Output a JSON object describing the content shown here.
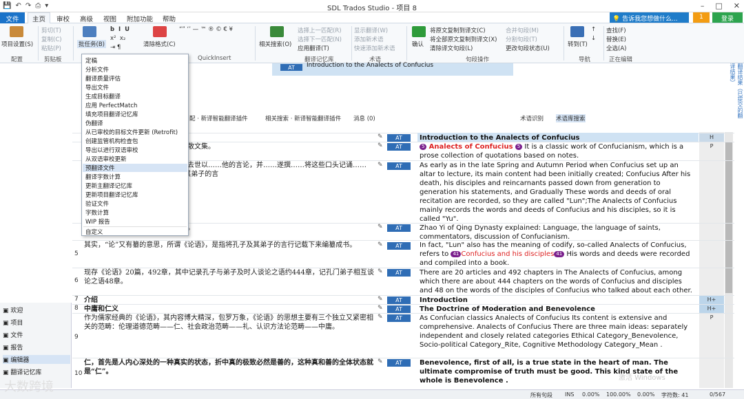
{
  "window": {
    "title": "SDL Trados Studio - 项目 8",
    "controls": [
      "–",
      "□",
      "✕"
    ]
  },
  "quick_access": [
    "💾",
    "↶",
    "↷",
    "⎙",
    "▾"
  ],
  "menu": {
    "file": "文件",
    "tabs": [
      "主页",
      "审校",
      "高级",
      "视图",
      "附加功能",
      "帮助"
    ],
    "active": "主页"
  },
  "tellme": "💡 告诉我您想做什么...",
  "notif_count": "1",
  "login": "登录",
  "ribbon": {
    "project_settings": "项目设置(S)",
    "config": "配置",
    "clipboard": "剪贴板",
    "cut": "剪切(T)",
    "copy": "复制(C)",
    "paste": "粘贴(P)",
    "batch": "批任务(B)",
    "clear_format": "清除格式(C)",
    "quickinsert": "QuickInsert",
    "related_search": "相关搜索(O)",
    "tm_group": "翻译记忆库",
    "prev_match": "选择上一匹配(R)",
    "next_match": "选择下一匹配(N)",
    "apply_trans": "应用翻译(T)",
    "show_term": "显示翻译(W)",
    "add_term": "添加新术语",
    "quick_add": "快速添加新术语",
    "term_group": "术语",
    "confirm": "确认",
    "copy_src": "将原文复制到译文(C)",
    "copy_all": "将全部原文复制到译文(X)",
    "clear_tgt": "清除译文句段(L)",
    "seg_group": "句段操作",
    "merge": "合并句段(M)",
    "split": "分割句段(T)",
    "change_status": "更改句段状态(U)",
    "goto": "转到(T)",
    "nav": "导航",
    "find": "查找(F)",
    "replace": "替换(E)",
    "selall": "全选(A)",
    "editing": "正在编辑"
  },
  "tm_result": {
    "status": "AT",
    "text": "Introduction to the Analects of Confucius"
  },
  "toolrow": [
    "配 · 新译智能翻译插件",
    "相关搜索 · 新译智能翻译插件",
    "消息 (0)",
    "术语识别",
    "术语库搜索"
  ],
  "vtab": "翻译结果（已提交的翻译结果）",
  "dropdown": [
    "定稿",
    "分析文件",
    "翻译质量评估",
    "导出文件",
    "生成目标翻译",
    "应用 PerfectMatch",
    "填充项目翻译记忆库",
    "伪翻译",
    "从已审校的目标文件更新 (Retrofit)",
    "创建监管机构检查包",
    "导出以进行双语审校",
    "从双语审校更新",
    "预翻译文件",
    "翻译字数计算",
    "更新主翻译记忆库",
    "更新项目翻译记忆库",
    "验证文件",
    "字数计算",
    "WIP 报告",
    "自定义"
  ],
  "dropdown_highlight": 12,
  "left_panel": [
    "欢迎",
    "项目",
    "文件",
    "报告",
    "编辑器",
    "翻译记忆库"
  ],
  "left_selected": 4,
  "segments": [
    {
      "num": "",
      "src": "",
      "tgt": "Introduction to the Analects of Confucius",
      "stat": "H"
    },
    {
      "num": "",
      "src": "之作，是一部以记言为主的语录体散文集。",
      "tgt_a": "Analects of Confucius",
      "tgt_b": "It is a classic work of Confucianism, which is a prose collection of quotations based on notes.",
      "stat": "P"
    },
    {
      "num": "",
      "src": "，其主体内容就已初始创成；孔子去世以……他的言论，并……遂撰……将这些口头记诵……为“论”；《论语》主要记载孔子及其弟子的言",
      "tgt": "As early as in the late Spring and Autumn Period when Confucius set up an altar to lecture, its main content had been initially created; Confucius After his death, his disciples and reincarnants passed down from generation to generation his statements, and Gradually These words and deeds of oral recitation are recorded, so they are called \"Lun\";The Analects of Confucius mainly records the words and deeds of Confucius and his disciples, so it is called \"Yu\".",
      "stat": ""
    },
    {
      "num": "",
      "src": "圣人之语言，论者，诸儒之讨论也。",
      "tgt": "Zhao Yi of Qing Dynasty explained: Language, the language of saints, commentators, discussion of Confucianism.",
      "stat": ""
    },
    {
      "num": "5",
      "src": "其实，“论”又有纂的意思，所谓《论语》，是指将孔子及其弟子的言行记载下来编纂成书。",
      "tgt_a": "In fact, \"Lun\" also has the meaning of codify, so-called Analects of Confucius, refers to",
      "tgt_b": "Confucius and his disciples",
      "tgt_c": "His words and deeds were recorded and compiled into a book.",
      "stat": ""
    },
    {
      "num": "6",
      "src": "现存《论语》20篇，492章，其中记录孔子与弟子及时人谈论之语约444章，记孔门弟子相互谈论之语48章。",
      "tgt": "There are 20 articles and 492 chapters in The Analects of Confucius, among which there are about 444 chapters on the words of Confucius and disciples and 48 on the words of the disciples of Confucius who talked about each other.",
      "stat": ""
    },
    {
      "num": "7",
      "src": "介绍",
      "tgt": "Introduction",
      "stat": "H+"
    },
    {
      "num": "8",
      "src": "中庸和仁义",
      "tgt": "The Doctrine of Moderation and Benevolence",
      "stat": "H+"
    },
    {
      "num": "9",
      "src": "作为儒家经典的《论语》，其内容博大精深，包罗万象，《论语》的思想主要有三个独立又紧密相关的范畴：伦理道德范畴——仁、社会政治范畴——礼、认识方法论范畴——中庸。",
      "tgt": "As Confucian classics Analects of Confucius Its content is extensive and comprehensive. Analects of Confucius There are three main ideas: separately independent and closely related categories Ethical Category_Benevolence, Socio-political Category_Rite, Cognitive Methodology Category_Mean .",
      "stat": "P"
    },
    {
      "num": "10",
      "src": "仁，首先是人内心深处的一种真实的状态，折中真的极致必然是善的，这种真和善的全体状态就是“仁”。",
      "tgt": "Benevolence, first of all, is a true state in the heart of man. The ultimate compromise of truth must be good. This kind state of the whole is Benevolence .",
      "stat": ""
    }
  ],
  "statusbar": [
    "所有句段",
    "INS",
    "0.00%",
    "100.00%",
    "0.00%",
    "字符数: 41",
    "0/567"
  ],
  "watermark": "大数跨境",
  "winact": "激活 Windows"
}
